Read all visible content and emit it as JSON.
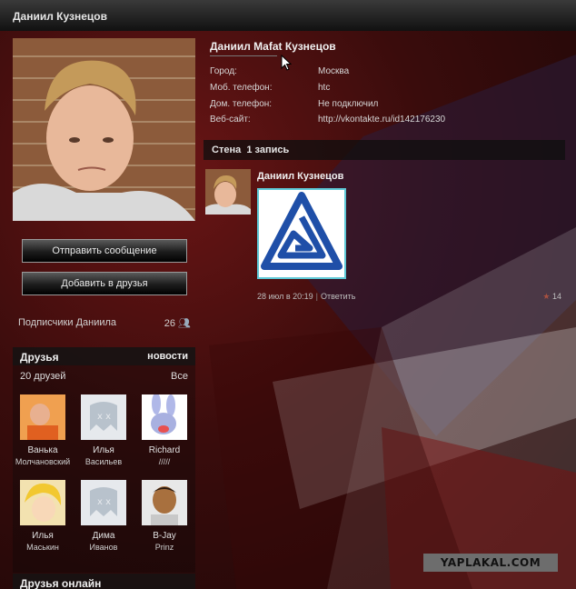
{
  "header": {
    "title": "Даниил Кузнецов"
  },
  "profile": {
    "full_name": "Даниил Mafat Кузнецов",
    "fields": [
      {
        "label": "Город:",
        "value": "Москва"
      },
      {
        "label": "Моб. телефон:",
        "value": "htc"
      },
      {
        "label": "Дом. телефон:",
        "value": "Не подключил"
      },
      {
        "label": "Веб-сайт:",
        "value": "http://vkontakte.ru/id142176230"
      }
    ]
  },
  "actions": {
    "send_message": "Отправить сообщение",
    "add_friend": "Добавить в друзья"
  },
  "subscribers": {
    "label": "Подписчики Даниила",
    "count": "26"
  },
  "friends": {
    "title": "Друзья",
    "news_link": "новости",
    "count_label": "20 друзей",
    "all_link": "Все",
    "items": [
      {
        "first": "Ванька",
        "last": "Молчановский"
      },
      {
        "first": "Илья",
        "last": "Васильев"
      },
      {
        "first": "Richard",
        "last": "/////"
      },
      {
        "first": "Илья",
        "last": "Маськин"
      },
      {
        "first": "Дима",
        "last": "Иванов"
      },
      {
        "first": "B-Jay",
        "last": "Prinz"
      }
    ]
  },
  "friends_online": {
    "title": "Друзья онлайн"
  },
  "wall": {
    "title": "Стена",
    "count": "1 запись",
    "post": {
      "author": "Даниил Кузнецов",
      "date": "28 июл в 20:19",
      "reply": "Ответить",
      "likes": "14"
    }
  },
  "watermark": "YAPLAKAL.COM",
  "colors": {
    "accent_border": "#5ec8d6",
    "logo_blue": "#1f4fa8"
  }
}
